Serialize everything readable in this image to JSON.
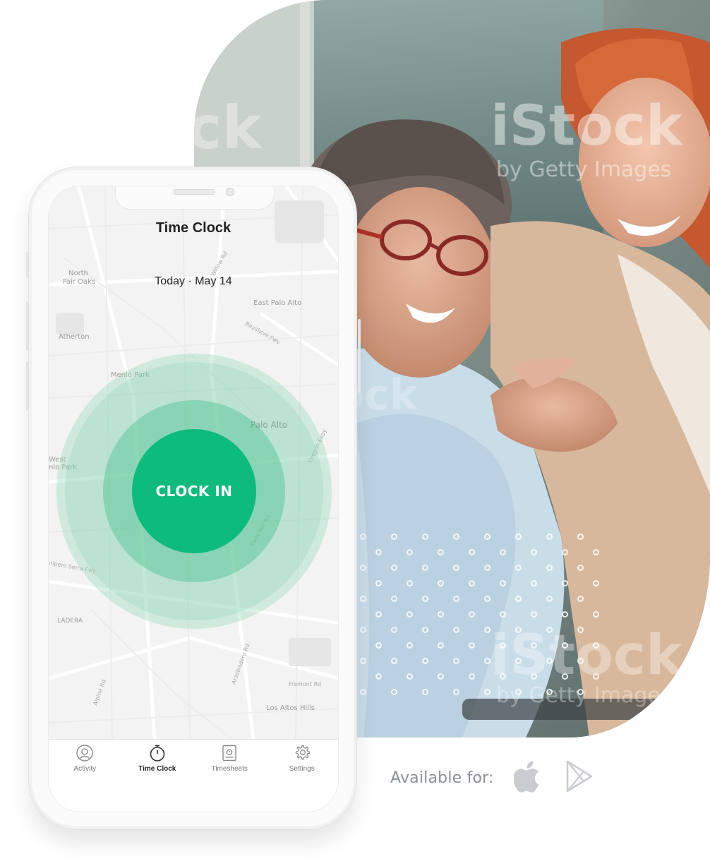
{
  "app": {
    "title": "Time Clock",
    "date": "Today · May 14",
    "clock_in_label": "CLOCK IN",
    "accent_color": "#0dbb7a"
  },
  "map": {
    "places": [
      "North",
      "Fair Oaks",
      "East Palo Alto",
      "Atherton",
      "Menlo Park",
      "Palo Alto",
      "West",
      "nlo Park",
      "LADERA",
      "Los Altos Hills"
    ],
    "roads": [
      "Bayshore Fwy",
      "Willow Rd",
      "Page Mill Rd",
      "nipero Serra Fwy",
      "Alpine Rd",
      "Oregon Expy",
      "Arastradero Rd",
      "Fremont Rd"
    ]
  },
  "tabs": [
    {
      "label": "Activity",
      "icon": "user-circle-icon",
      "active": false
    },
    {
      "label": "Time Clock",
      "icon": "stopwatch-icon",
      "active": true
    },
    {
      "label": "Timesheets",
      "icon": "timesheet-icon",
      "active": false
    },
    {
      "label": "Settings",
      "icon": "gear-icon",
      "active": false
    }
  ],
  "photo": {
    "watermark": "iStock",
    "watermark_sub": "by Getty Images"
  },
  "availability": {
    "label": "Available for:",
    "platforms": [
      "apple-icon",
      "google-play-icon"
    ]
  }
}
